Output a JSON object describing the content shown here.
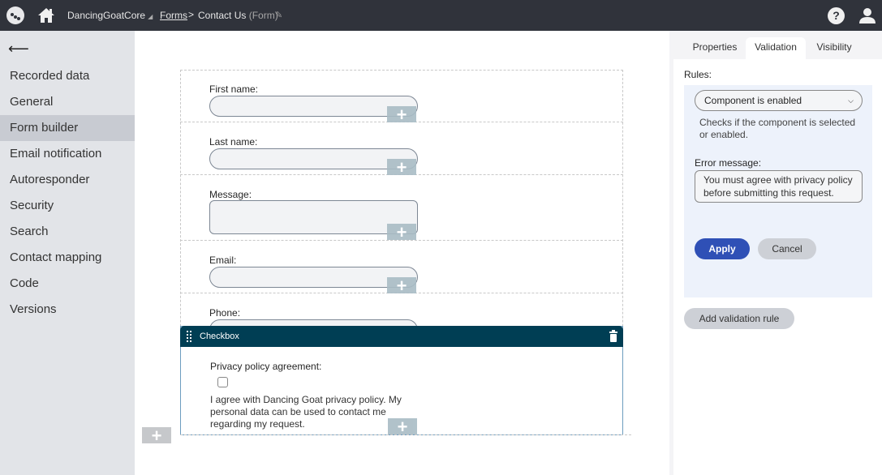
{
  "header": {
    "site_name": "DancingGoatCore",
    "breadcrumb_parent": "Forms",
    "breadcrumb_separator": ">",
    "breadcrumb_current": "Contact Us",
    "breadcrumb_type": "(Form)",
    "icons": [
      "app-logo-icon",
      "home-icon",
      "pin-icon",
      "help-icon",
      "user-icon"
    ]
  },
  "sidebar": {
    "back_glyph": "⟵",
    "items": [
      {
        "label": "Recorded data",
        "active": false
      },
      {
        "label": "General",
        "active": false
      },
      {
        "label": "Form builder",
        "active": true
      },
      {
        "label": "Email notification",
        "active": false
      },
      {
        "label": "Autoresponder",
        "active": false
      },
      {
        "label": "Security",
        "active": false
      },
      {
        "label": "Search",
        "active": false
      },
      {
        "label": "Contact mapping",
        "active": false
      },
      {
        "label": "Code",
        "active": false
      },
      {
        "label": "Versions",
        "active": false
      }
    ]
  },
  "form": {
    "fields": [
      {
        "label": "First name:",
        "type": "text",
        "value": ""
      },
      {
        "label": "Last name:",
        "type": "text",
        "value": ""
      },
      {
        "label": "Message:",
        "type": "textarea",
        "value": ""
      },
      {
        "label": "Email:",
        "type": "text",
        "value": ""
      },
      {
        "label": "Phone:",
        "type": "text",
        "value": ""
      }
    ],
    "selected_widget": {
      "title": "Checkbox",
      "label": "Privacy policy agreement:",
      "checked": false,
      "text": "I agree with Dancing Goat privacy policy. My personal data can be used to contact me regarding my request."
    },
    "add_glyph": "+"
  },
  "panel": {
    "tabs": [
      {
        "label": "Properties",
        "active": false
      },
      {
        "label": "Validation",
        "active": true
      },
      {
        "label": "Visibility",
        "active": false
      }
    ],
    "rules_label": "Rules:",
    "rule_selected": "Component is enabled",
    "rule_description": "Checks if the component is selected or enabled.",
    "error_label": "Error message:",
    "error_message": "You must agree with privacy policy before submitting this request.",
    "apply_label": "Apply",
    "cancel_label": "Cancel",
    "add_rule_label": "Add validation rule"
  },
  "colors": {
    "topbar": "#30333b",
    "widget_header": "#003e54",
    "apply": "#2f50b6",
    "sidebar_active": "#c8cbd2"
  }
}
